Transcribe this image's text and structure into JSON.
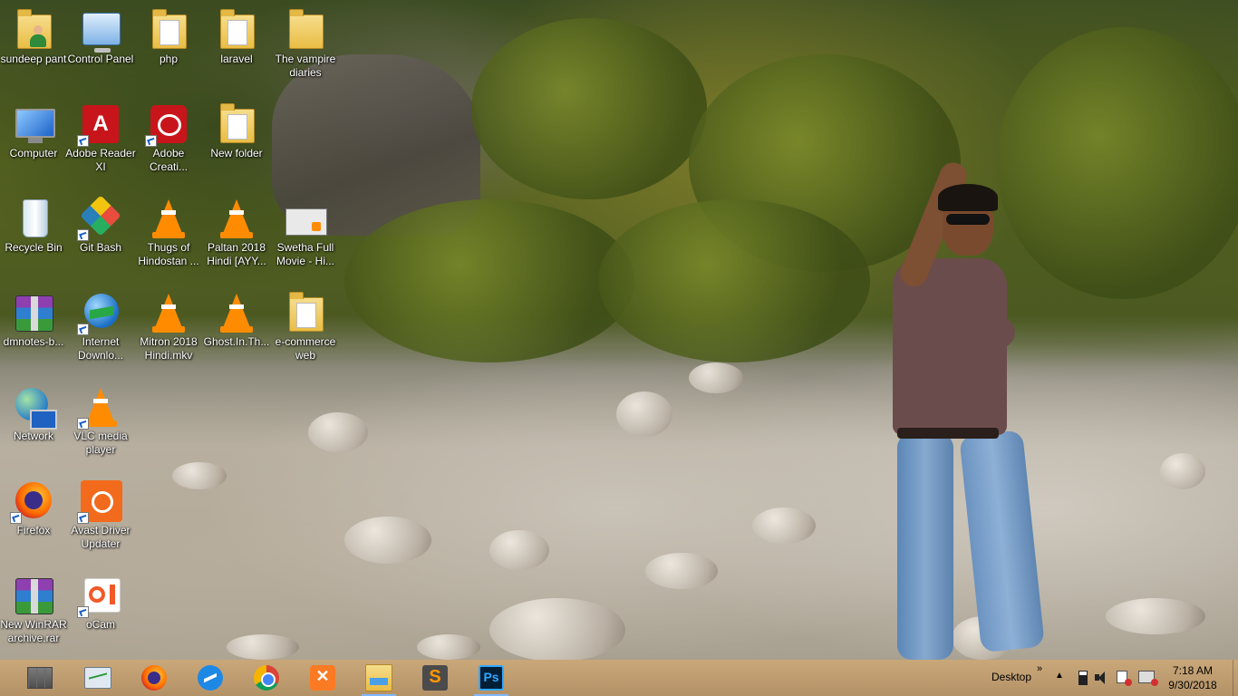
{
  "desktop": {
    "icons": [
      {
        "label": "sundeep pant"
      },
      {
        "label": "Control Panel"
      },
      {
        "label": "php"
      },
      {
        "label": "laravel"
      },
      {
        "label": "The vampire diaries"
      },
      {
        "label": "Computer"
      },
      {
        "label": "Adobe Reader XI"
      },
      {
        "label": "Adobe Creati..."
      },
      {
        "label": "New folder"
      },
      {
        "label": "Recycle Bin"
      },
      {
        "label": "Git Bash"
      },
      {
        "label": "Thugs of Hindostan ..."
      },
      {
        "label": "Paltan 2018 Hindi [AYY..."
      },
      {
        "label": "Swetha Full Movie - Hi..."
      },
      {
        "label": "dmnotes-b..."
      },
      {
        "label": "Internet Downlo..."
      },
      {
        "label": "Mitron 2018 Hindi.mkv"
      },
      {
        "label": "Ghost.In.Th..."
      },
      {
        "label": "e-commerce web"
      },
      {
        "label": "Network"
      },
      {
        "label": "VLC media player"
      },
      {
        "label": "Firefox"
      },
      {
        "label": "Avast Driver Updater"
      },
      {
        "label": "New WinRAR archive.rar"
      },
      {
        "label": "oCam"
      }
    ]
  },
  "taskbar": {
    "pinned": [
      {
        "icon": "start-icon"
      },
      {
        "icon": "task-manager-icon"
      },
      {
        "icon": "firefox-icon"
      },
      {
        "icon": "messenger-icon"
      },
      {
        "icon": "chrome-icon"
      },
      {
        "icon": "xampp-icon"
      },
      {
        "icon": "file-explorer-icon"
      },
      {
        "icon": "sublime-text-icon"
      },
      {
        "icon": "photoshop-icon"
      }
    ],
    "desktop_toolbar_label": "Desktop",
    "chevron": "»",
    "tray_up": "▲",
    "time": "7:18 AM",
    "date": "9/30/2018"
  },
  "colors": {
    "taskbar_bg": "#c4a06e",
    "label_text": "#ffffff"
  }
}
